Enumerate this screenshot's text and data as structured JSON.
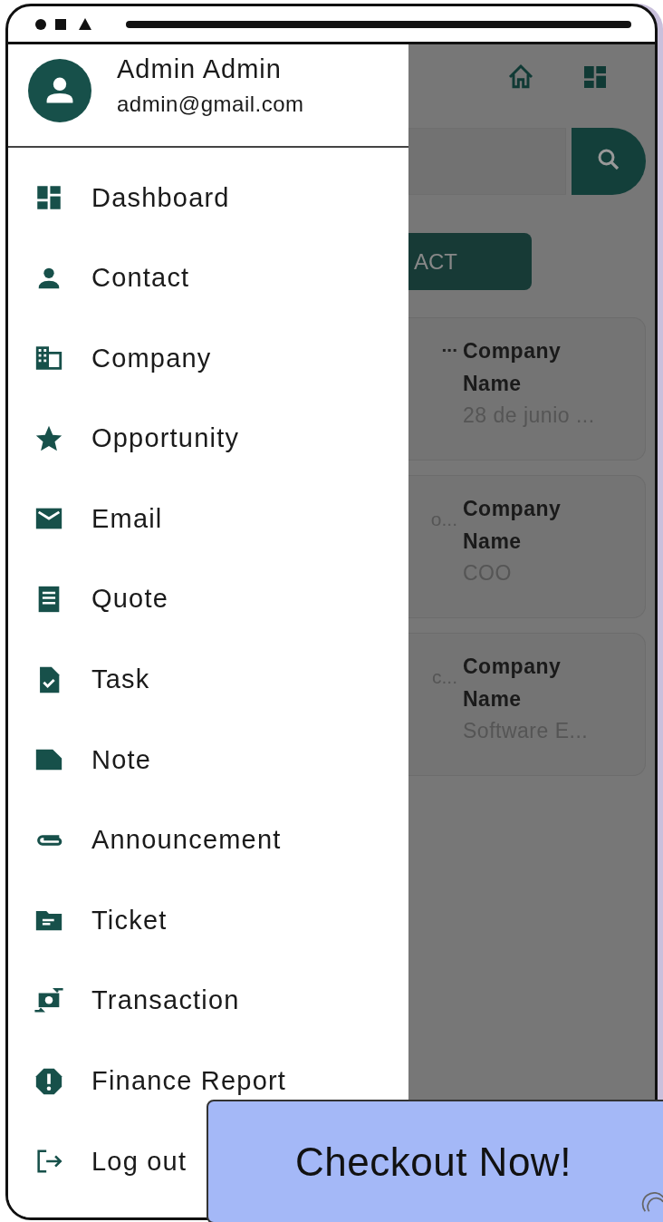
{
  "drawer": {
    "user": {
      "name": "Admin Admin",
      "email": "admin@gmail.com"
    },
    "items": [
      {
        "label": "Dashboard"
      },
      {
        "label": "Contact"
      },
      {
        "label": "Company"
      },
      {
        "label": "Opportunity"
      },
      {
        "label": "Email"
      },
      {
        "label": "Quote"
      },
      {
        "label": "Task"
      },
      {
        "label": "Note"
      },
      {
        "label": "Announcement"
      },
      {
        "label": "Ticket"
      },
      {
        "label": "Transaction"
      },
      {
        "label": "Finance Report"
      },
      {
        "label": "Log out"
      }
    ]
  },
  "background": {
    "add_button": "ACT",
    "cards": [
      {
        "fragment_1": "...",
        "title": "Company Name",
        "detail": "28 de junio ..."
      },
      {
        "fragment_2": "o...",
        "title": "Company Name",
        "detail": "COO"
      },
      {
        "fragment_2": "c...",
        "title": "Company Name",
        "detail": "Software E..."
      }
    ]
  },
  "banner": {
    "label": "Checkout Now!"
  }
}
